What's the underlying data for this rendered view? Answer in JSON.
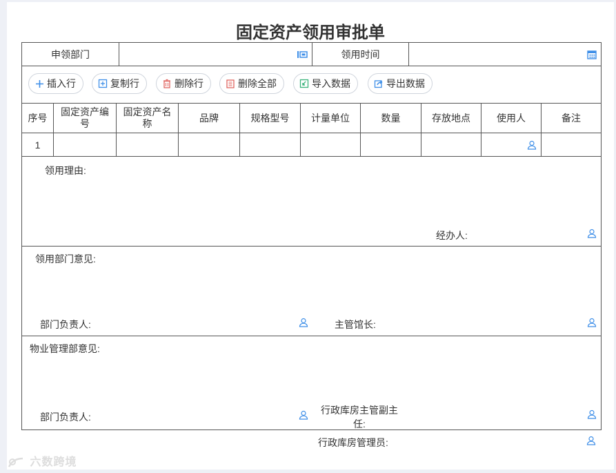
{
  "form_title": "固定资产领用审批单",
  "header": {
    "dept_label": "申领部门",
    "dept_value": "",
    "time_label": "领用时间",
    "time_value": ""
  },
  "toolbar": {
    "insert_row": "插入行",
    "copy_row": "复制行",
    "delete_row": "删除行",
    "delete_all": "删除全部",
    "import_data": "导入数据",
    "export_data": "导出数据"
  },
  "table": {
    "columns": [
      "序号",
      "固定资产编号",
      "固定资产名称",
      "品牌",
      "规格型号",
      "计量单位",
      "数量",
      "存放地点",
      "使用人",
      "备注"
    ],
    "rows": [
      {
        "seq": "1",
        "asset_no": "",
        "asset_name": "",
        "brand": "",
        "model": "",
        "unit": "",
        "qty": "",
        "location": "",
        "user": "",
        "remark": ""
      }
    ]
  },
  "reason": {
    "label": "领用理由:",
    "handler_label": "经办人:"
  },
  "dept_opinion": {
    "label": "领用部门意见:",
    "head_label": "部门负责人:",
    "curator_label": "主管馆长:"
  },
  "property_opinion": {
    "label": "物业管理部意见:",
    "head_label": "部门负责人:",
    "deputy_label": "行政库房主管副主任:"
  },
  "warehouse_admin_label": "行政库房管理员:",
  "watermark": "六数跨境",
  "colors": {
    "accent": "#3d8ee8",
    "border": "#555555",
    "delete_red": "#e0645f",
    "import_green": "#39b27a"
  }
}
